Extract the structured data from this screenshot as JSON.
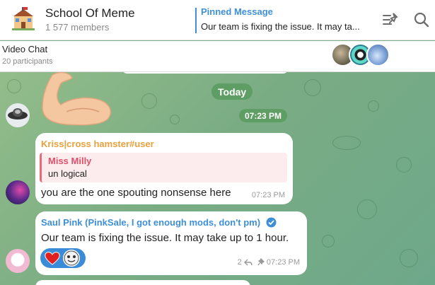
{
  "header": {
    "title": "School Of Meme",
    "members": "1 577 members",
    "pinned_title": "Pinned Message",
    "pinned_text": "Our team is fixing the issue. It may ta..."
  },
  "video_chat": {
    "title": "Video Chat",
    "participants": "20 participants"
  },
  "chat": {
    "day_label": "Today",
    "time_label": "07:23 PM",
    "messages": [
      {
        "sender": "Kriss|cross hamster#user",
        "sender_color": "#e8a13d",
        "reply_name": "Miss Milly",
        "reply_text": "un logical",
        "text": "you are the one spouting nonsense here",
        "time": "07:23 PM"
      },
      {
        "sender": "Saul Pink (PinkSale, I got enough mods, don't pm)",
        "sender_color": "#3f8fd6",
        "verified": true,
        "text": "Our team is fixing the issue. It may take up to 1 hour.",
        "reply_count": "2",
        "time": "07:23 PM",
        "reactions": [
          "red-heart",
          "avatar"
        ]
      }
    ]
  },
  "colors": {
    "accent": "#3f8fd6",
    "pill": "#5e9e64",
    "reaction_bg": "#3a8bd8"
  }
}
